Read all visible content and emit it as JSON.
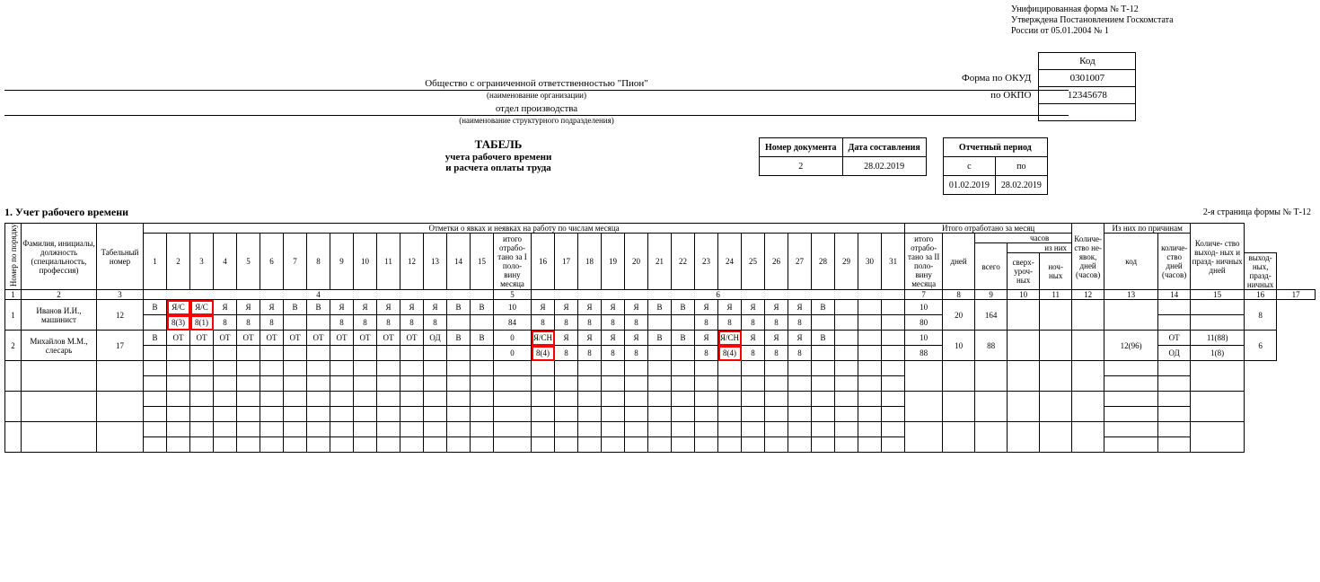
{
  "form": {
    "line1": "Унифицированная форма № Т-12",
    "line2": "Утверждена Постановлением Госкомстата",
    "line3": "России от 05.01.2004 № 1"
  },
  "codes": {
    "h_kod": "Код",
    "okud_l": "Форма по ОКУД",
    "okud": "0301007",
    "okpo_l": "по ОКПО",
    "okpo": "12345678"
  },
  "org": {
    "name": "Общество с ограниченной ответственностью \"Пион\"",
    "name_sub": "(наименование организации)",
    "dept": "отдел производства",
    "dept_sub": "(наименование структурного подразделения)"
  },
  "title": {
    "t1": "ТАБЕЛЬ",
    "t2": "учета рабочего времени",
    "t3": "и расчета оплаты труда"
  },
  "docinfo": {
    "h_num": "Номер документа",
    "h_date": "Дата составления",
    "num": "2",
    "date": "28.02.2019",
    "period_h": "Отчетный период",
    "from_l": "с",
    "to_l": "по",
    "from": "01.02.2019",
    "to": "28.02.2019"
  },
  "sec1": "1. Учет рабочего времени",
  "pg2": "2-я страница формы № Т-12",
  "head": {
    "c1": "Номер по порядку",
    "c2": "Фамилия, инициалы, должность (специальность, профессия)",
    "c3": "Табельный номер",
    "marks": "Отметки о явках и неявках на работу по числам месяца",
    "half1": "итого отрабо-\nтано за I поло-\nвину месяца",
    "half2": "итого отрабо-\nтано за II поло-\nвину месяца",
    "total_h": "Итого отработано за месяц",
    "days": "дней",
    "hours": "часов",
    "vsego": "всего",
    "iznih": "из них",
    "over": "сверх-\nуроч-\nных",
    "night": "ноч-\nных",
    "holi": "выход-\nных, празд-\nничных",
    "absent": "Количе-\nство не-\nявок, дней (часов)",
    "reasons": "Из них по причинам",
    "r_code": "код",
    "r_days": "количе-\nство дней (часов)",
    "weekend": "Количе-\nство выход-\nных и празд-\nничных дней"
  },
  "nums": {
    "c1": "1",
    "c2": "2",
    "c3": "3",
    "c4": "4",
    "c5": "5",
    "c6": "6",
    "c7": "7",
    "c8": "8",
    "c9": "9",
    "c10": "10",
    "c11": "11",
    "c12": "12",
    "c13": "13",
    "c14": "14",
    "c15": "15",
    "c16": "16",
    "c17": "17"
  },
  "days1": [
    "1",
    "2",
    "3",
    "4",
    "5",
    "6",
    "7",
    "8",
    "9",
    "10",
    "11",
    "12",
    "13",
    "14",
    "15"
  ],
  "days2": [
    "16",
    "17",
    "18",
    "19",
    "20",
    "21",
    "22",
    "23",
    "24",
    "25",
    "26",
    "27",
    "28",
    "29",
    "30",
    "31"
  ],
  "r1": {
    "n": "1",
    "name": "Иванов И.И., машинист",
    "tab": "12",
    "m1": [
      "В",
      "Я/С",
      "Я/С",
      "Я",
      "Я",
      "Я",
      "В",
      "В",
      "Я",
      "Я",
      "Я",
      "Я",
      "Я",
      "В",
      "В"
    ],
    "m2": [
      "Я",
      "Я",
      "Я",
      "Я",
      "Я",
      "В",
      "В",
      "Я",
      "Я",
      "Я",
      "Я",
      "Я",
      "В",
      "",
      "",
      ""
    ],
    "h1": [
      "",
      "8(3)",
      "8(1)",
      "8",
      "8",
      "8",
      "",
      "",
      "8",
      "8",
      "8",
      "8",
      "8",
      "",
      ""
    ],
    "h2": [
      "8",
      "8",
      "8",
      "8",
      "8",
      "",
      "",
      "8",
      "8",
      "8",
      "8",
      "8",
      "",
      "",
      "",
      ""
    ],
    "t1m": "10",
    "t1h": "84",
    "t2m": "10",
    "t2h": "80",
    "td": "20",
    "th": "164",
    "we": "8"
  },
  "r2": {
    "n": "2",
    "name": "Михайлов М.М., слесарь",
    "tab": "17",
    "m1": [
      "В",
      "ОТ",
      "ОТ",
      "ОТ",
      "ОТ",
      "ОТ",
      "ОТ",
      "ОТ",
      "ОТ",
      "ОТ",
      "ОТ",
      "ОТ",
      "ОД",
      "В",
      "В"
    ],
    "m2": [
      "Я/СН",
      "Я",
      "Я",
      "Я",
      "Я",
      "В",
      "В",
      "Я",
      "Я/СН",
      "Я",
      "Я",
      "Я",
      "В",
      "",
      "",
      ""
    ],
    "h1": [
      "",
      "",
      "",
      "",
      "",
      "",
      "",
      "",
      "",
      "",
      "",
      "",
      "",
      "",
      ""
    ],
    "h2": [
      "8(4)",
      "8",
      "8",
      "8",
      "8",
      "",
      "",
      "8",
      "8(4)",
      "8",
      "8",
      "8",
      "",
      "",
      "",
      ""
    ],
    "t1m": "0",
    "t1h": "0",
    "t2m": "10",
    "t2h": "88",
    "td": "10",
    "th": "88",
    "abs": "12(96)",
    "rc1": "ОТ",
    "rd1": "11(88)",
    "rc2": "ОД",
    "rd2": "1(8)",
    "we": "6"
  }
}
